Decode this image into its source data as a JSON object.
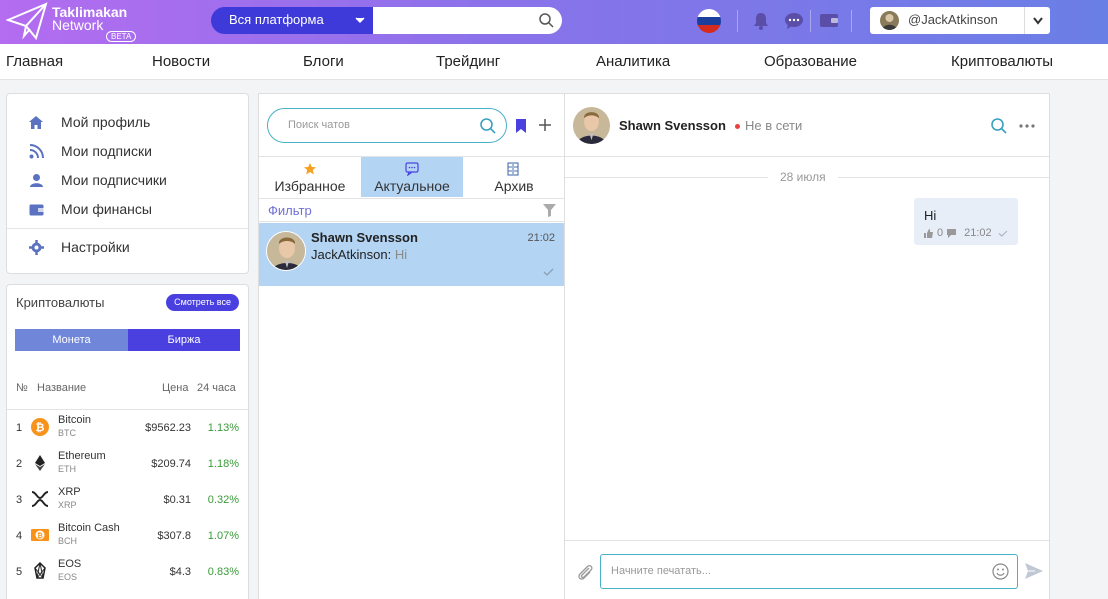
{
  "header": {
    "logo_line1": "Taklimakan",
    "logo_line2": "Network",
    "logo_badge": "BETA",
    "platform_select": "Вся платформа",
    "search_placeholder": "",
    "user_name": "@JackAtkinson"
  },
  "nav": {
    "items": [
      "Главная",
      "Новости",
      "Блоги",
      "Трейдинг",
      "Аналитика",
      "Образование",
      "Криптовалюты"
    ]
  },
  "profile_menu": {
    "items": [
      {
        "label": "Мой профиль",
        "icon": "home-icon"
      },
      {
        "label": "Мои подписки",
        "icon": "rss-icon"
      },
      {
        "label": "Мои подписчики",
        "icon": "user-icon"
      },
      {
        "label": "Мои финансы",
        "icon": "wallet-icon"
      }
    ],
    "settings_label": "Настройки"
  },
  "crypto": {
    "title": "Криптовалюты",
    "see_all": "Смотреть все",
    "tab_coin": "Монета",
    "tab_exchange": "Биржа",
    "col_rank": "№",
    "col_name": "Название",
    "col_price": "Цена",
    "col_change": "24 часа",
    "rows": [
      {
        "rank": "1",
        "name": "Bitcoin",
        "symbol": "BTC",
        "price": "$9562.23",
        "change": "1.13%",
        "color": "#f7931a"
      },
      {
        "rank": "2",
        "name": "Ethereum",
        "symbol": "ETH",
        "price": "$209.74",
        "change": "1.18%",
        "color": "#222222"
      },
      {
        "rank": "3",
        "name": "XRP",
        "symbol": "XRP",
        "price": "$0.31",
        "change": "0.32%",
        "color": "#222222"
      },
      {
        "rank": "4",
        "name": "Bitcoin Cash",
        "symbol": "BCH",
        "price": "$307.8",
        "change": "1.07%",
        "color": "#f7931a"
      },
      {
        "rank": "5",
        "name": "EOS",
        "symbol": "EOS",
        "price": "$4.3",
        "change": "0.83%",
        "color": "#222222"
      }
    ]
  },
  "chats": {
    "search_placeholder": "Поиск чатов",
    "tabs": [
      {
        "label": "Избранное",
        "icon": "star-icon"
      },
      {
        "label": "Актуальное",
        "icon": "chat-bubble-icon"
      },
      {
        "label": "Архив",
        "icon": "archive-icon"
      }
    ],
    "filter_label": "Фильтр",
    "items": [
      {
        "name": "Shawn Svensson",
        "time": "21:02",
        "sender": "JackAtkinson:",
        "message": "Hi"
      }
    ]
  },
  "conversation": {
    "name": "Shawn Svensson",
    "status": "Не в сети",
    "date": "28 июля",
    "messages": [
      {
        "text": "Hi",
        "likes": "0",
        "time": "21:02"
      }
    ],
    "input_placeholder": "Начните печатать..."
  },
  "colors": {
    "accent": "#4a40e0",
    "header_start": "#b46cf0",
    "header_end": "#6a7fe6",
    "active_tab": "#b3d4f3",
    "positive": "#3a9a3a"
  }
}
